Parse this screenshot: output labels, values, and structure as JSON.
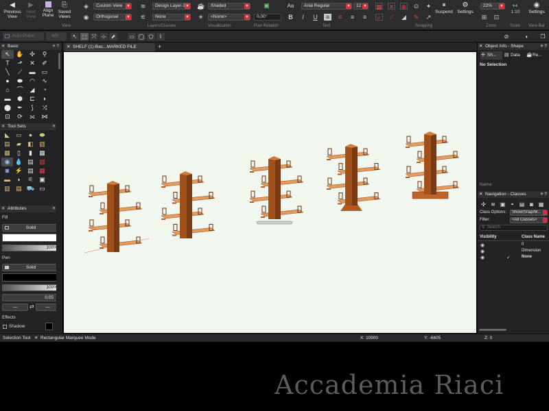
{
  "toolbar": {
    "previous_view": "Previous View",
    "next_view": "Next View",
    "align_plane": "Align Plane",
    "saved_views": "Saved Views",
    "view_dropdown": "Custom View",
    "projection_dropdown": "Orthogonal",
    "layer_dropdown": "Design Layer-1",
    "class_dropdown": "None",
    "render_dropdown": "Shaded",
    "lighting_dropdown": "<None>",
    "plan_rotation_value": "0,00°",
    "font_dropdown": "Arial Regular",
    "font_size": "12",
    "suspend": "Suspend",
    "settings": "Settings",
    "zoom_value": "22%",
    "scale_value": "1:10",
    "viewbar_settings": "Settings",
    "groups": {
      "view": "View",
      "layers_classes": "Layers/Classes",
      "visualization": "Visualization",
      "plan_rotation": "Plan Rotation",
      "text": "Text",
      "snapping": "Snapping",
      "zoom": "Zoom",
      "scale": "Scale",
      "view_bar": "View Bar"
    }
  },
  "modebar": {
    "auto_plane": "Auto-Plane",
    "wp": "WP"
  },
  "document": {
    "tab_title": "SHELF (1)-Bac...MARKED FILE",
    "accent_color": "#d0373c",
    "shelf_color": "#e39a5c",
    "post_color": "#a0501a"
  },
  "palettes": {
    "basic": "Basic",
    "tool_sets": "Tool Sets",
    "attributes": "Attributes",
    "fill_label": "Fill",
    "fill_style": "Solid",
    "fill_opacity": "100%",
    "pen_label": "Pen",
    "pen_style": "Solid",
    "pen_opacity": "100%",
    "line_weight": "0,05",
    "effects_label": "Effects",
    "shadow_label": "Shadow"
  },
  "object_info": {
    "title": "Object Info - Shape",
    "tab_shape": "Sh...",
    "tab_data": "Data",
    "tab_render": "Re...",
    "selection": "No Selection",
    "name_label": "Name:"
  },
  "navigation": {
    "title": "Navigation - Classes",
    "class_options_label": "Class Options:",
    "class_options_value": "Show/Snap/M...",
    "filter_label": "Filter:",
    "filter_value": "<All Classes>",
    "search_placeholder": "Search",
    "col_visibility": "Visibility",
    "col_class_name": "Class Name",
    "classes": [
      "0",
      "Dimension",
      "None"
    ]
  },
  "status": {
    "tool": "Selection Tool",
    "mode": "Rectangular Marquee Mode",
    "x": "X: 10900",
    "y": "Y: -6605",
    "z": "Z: 0"
  },
  "watermark": "Accademia Riaci"
}
